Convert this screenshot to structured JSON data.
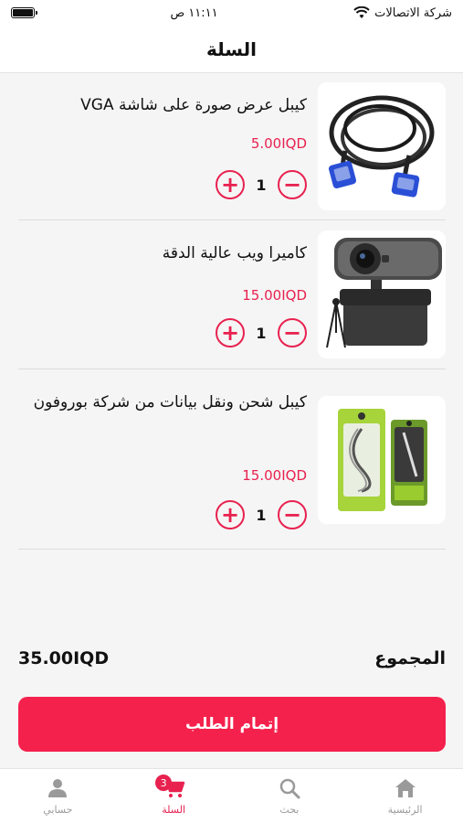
{
  "status_bar": {
    "carrier": "شركة الاتصالات",
    "time": "١١:١١ ص"
  },
  "header": {
    "title": "السلة"
  },
  "cart": {
    "items": [
      {
        "name": "كيبل عرض صورة على شاشة VGA",
        "price": "5.00IQD",
        "quantity": "1",
        "image_icon": "vga-cable-image"
      },
      {
        "name": "كاميرا ويب عالية الدقة",
        "price": "15.00IQD",
        "quantity": "1",
        "image_icon": "webcam-image"
      },
      {
        "name": "كيبل شحن ونقل بيانات من شركة بوروفون",
        "price": "15.00IQD",
        "quantity": "1",
        "image_icon": "charging-cable-image"
      }
    ]
  },
  "summary": {
    "total_label": "المجموع",
    "total_amount": "35.00IQD"
  },
  "checkout": {
    "label": "إتمام الطلب"
  },
  "tabbar": {
    "tabs": [
      {
        "label": "حسابي",
        "icon": "person-icon"
      },
      {
        "label": "السلة",
        "icon": "cart-icon",
        "badge": "3",
        "active": true
      },
      {
        "label": "بحث",
        "icon": "search-icon"
      },
      {
        "label": "الرئيسية",
        "icon": "home-icon"
      }
    ]
  },
  "colors": {
    "accent": "#e8214f",
    "checkout": "#f5214d",
    "background": "#f5f5f5"
  }
}
